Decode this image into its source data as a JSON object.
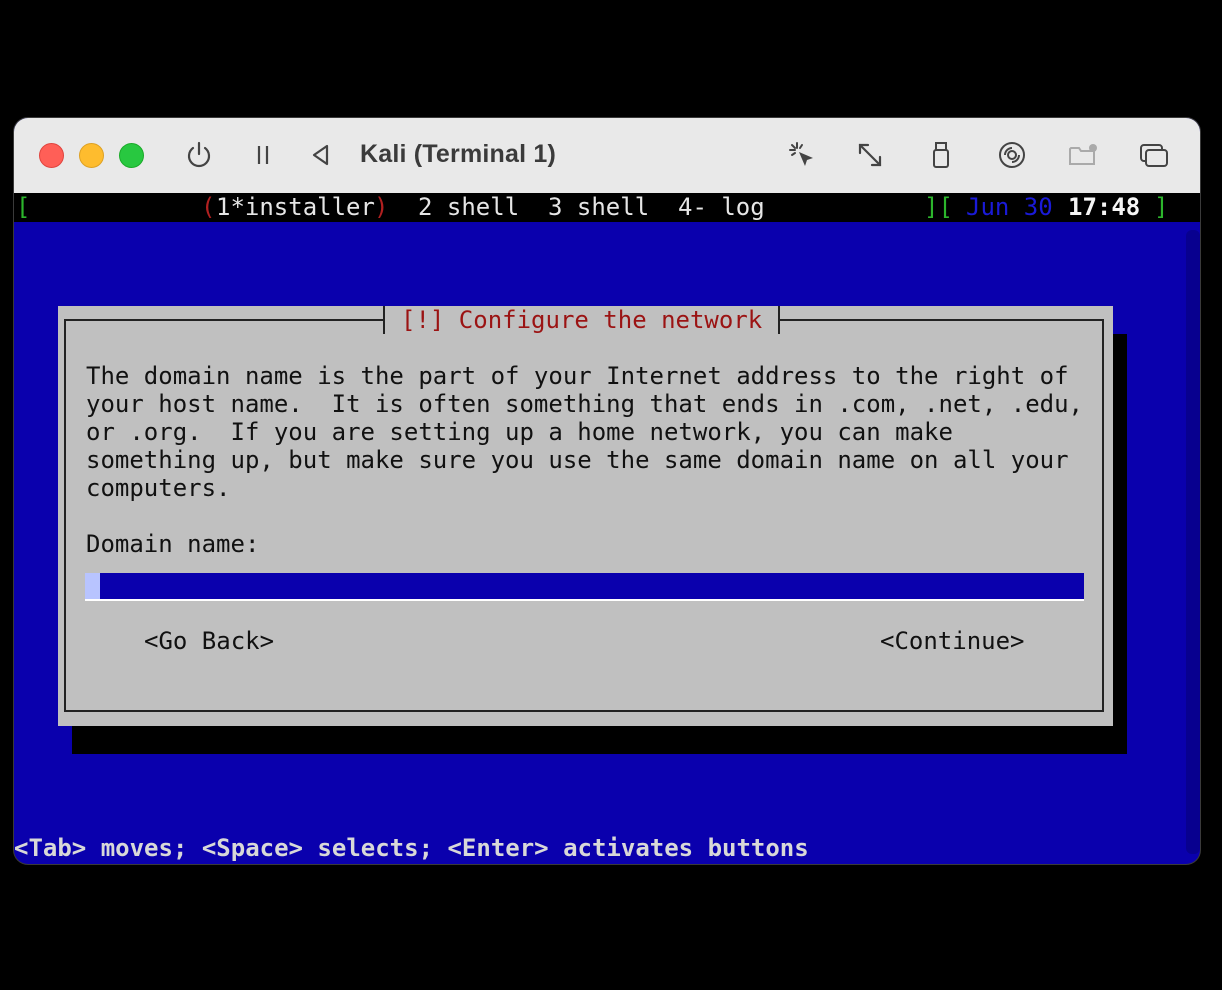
{
  "window": {
    "title": "Kali (Terminal 1)"
  },
  "toolbar": {
    "icons": [
      "power-icon",
      "pause-icon",
      "back-icon",
      "capture-icon",
      "resize-icon",
      "usb-icon",
      "disc-icon",
      "shared-folder-icon",
      "display-icon"
    ]
  },
  "screen_bar": {
    "left_bracket": "[",
    "active_open": "(",
    "active_tab": "1*installer",
    "active_close": ")",
    "tab2": "2 shell",
    "tab3": "3 shell",
    "tab4": "4- log",
    "right_brackets": "][",
    "date": "Jun 30",
    "time": "17:48",
    "end_bracket": "]"
  },
  "dialog": {
    "title": "[!] Configure the network",
    "description": "The domain name is the part of your Internet address to the right of\nyour host name.  It is often something that ends in .com, .net, .edu,\nor .org.  If you are setting up a home network, you can make\nsomething up, but make sure you use the same domain name on all your\ncomputers.",
    "field_label": "Domain name:",
    "field_value": "",
    "go_back": "<Go Back>",
    "continue": "<Continue>"
  },
  "help_line": "<Tab> moves; <Space> selects; <Enter> activates buttons",
  "colors": {
    "terminal_bg": "#0a00ad",
    "dialog_bg": "#c0c0c0",
    "title_red": "#9b1313"
  }
}
